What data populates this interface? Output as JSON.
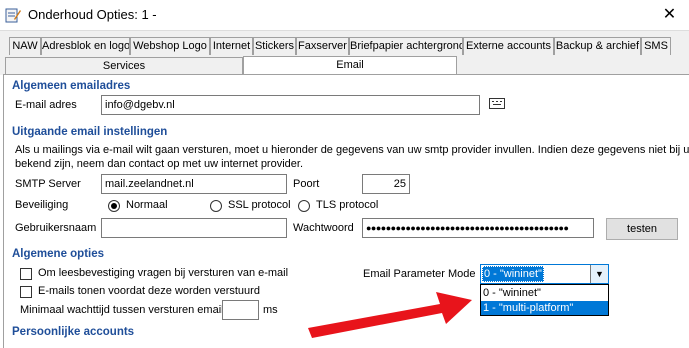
{
  "window": {
    "title": "Onderhoud Opties: 1 -",
    "close_glyph": "✕"
  },
  "tabs_row1": [
    "NAW",
    "Adresblok en logo",
    "Webshop Logo",
    "Internet",
    "Stickers",
    "Faxserver",
    "Briefpapier achtergrond",
    "Externe accounts",
    "Backup & archief",
    "SMS"
  ],
  "tabs_row2": [
    "Services",
    "Email"
  ],
  "active_tab": "Email",
  "sections": {
    "general_email": "Algemeen emailadres",
    "outgoing": "Uitgaande email instellingen",
    "general_options": "Algemene opties",
    "personal_accounts": "Persoonlijke accounts"
  },
  "email_address": {
    "label": "E-mail adres",
    "value": "info@dgebv.nl",
    "icon": "card-icon"
  },
  "outgoing_info_line1": "Als u mailings via e-mail wilt gaan versturen, moet u hieronder de gegevens van uw smtp provider invullen. Indien deze gegevens niet bij uw",
  "outgoing_info_line2": "bekend zijn, neem dan contact op met uw internet provider.",
  "smtp": {
    "label": "SMTP Server",
    "value": "mail.zeelandnet.nl"
  },
  "port": {
    "label": "Poort",
    "value": "25"
  },
  "security": {
    "label": "Beveiliging",
    "options": [
      "Normaal",
      "SSL protocol",
      "TLS protocol"
    ],
    "selected": "Normaal"
  },
  "username": {
    "label": "Gebruikersnaam",
    "value": ""
  },
  "password": {
    "label": "Wachtwoord",
    "value": "●●●●●●●●●●●●●●●●●●●●●●●●●●●●●●●●●●●●●●●●●"
  },
  "test_button": "testen",
  "options": {
    "read_receipt": "Om leesbevestiging vragen bij versturen van e-mail",
    "show_emails": "E-mails tonen voordat deze worden verstuurd",
    "min_wait_label": "Minimaal wachttijd tussen versturen emails",
    "min_wait_value": "",
    "min_wait_unit": "ms"
  },
  "email_param": {
    "label": "Email Parameter Mode",
    "selected": "0 - \"wininet\"",
    "options": [
      "0 - \"wininet\"",
      "1 - \"multi-platform\""
    ],
    "highlighted": "1 - \"multi-platform\""
  },
  "colors": {
    "accent": "#0078d7",
    "section_header": "#1f4e99",
    "arrow": "#e8141b"
  }
}
